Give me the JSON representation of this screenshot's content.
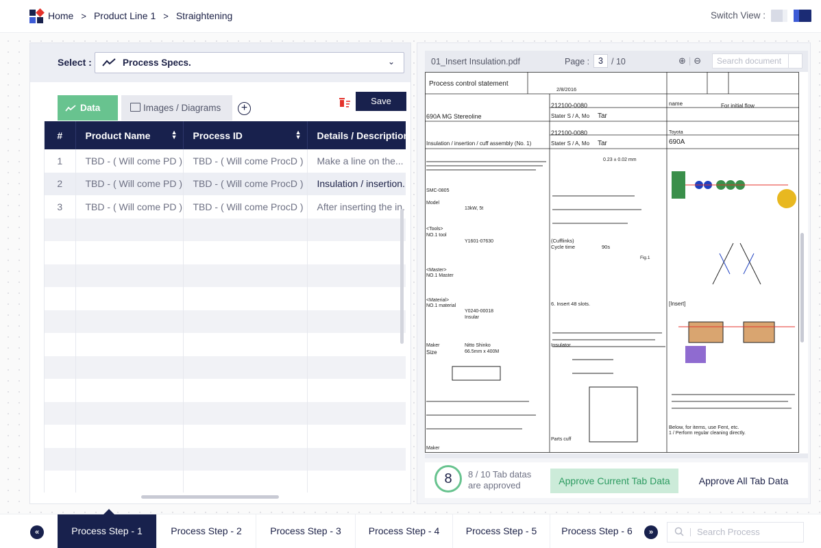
{
  "breadcrumb": {
    "home": "Home",
    "product_line": "Product Line 1",
    "current": "Straightening",
    "separator": ">"
  },
  "switch_view": {
    "label": "Switch View :"
  },
  "select": {
    "label": "Select :",
    "value": "Process Specs.",
    "icon": "trend-line-icon"
  },
  "tabs": {
    "data": "Data",
    "images": "Images / Diagrams"
  },
  "toolbar": {
    "save": "Save"
  },
  "table": {
    "columns": [
      "#",
      "Product Name",
      "Process ID",
      "Details / Description"
    ],
    "rows": [
      {
        "num": "1",
        "product": "TBD - ( Will come PD )",
        "process": "TBD - ( Will come ProcD )",
        "details": "Make a line on the..."
      },
      {
        "num": "2",
        "product": "TBD - ( Will come PD )",
        "process": "TBD - ( Will come ProcD )",
        "details": "Insulation / insertion.."
      },
      {
        "num": "3",
        "product": "TBD - ( Will come PD )",
        "process": "TBD - ( Will come ProcD )",
        "details": "After inserting the in.."
      }
    ]
  },
  "viewer": {
    "file_name": "01_Insert Insulation.pdf",
    "page_label": "Page :",
    "page": "3",
    "total": "/ 10",
    "search_placeholder": "Search document",
    "doc": {
      "title": "Process control statement",
      "date": "2/8/2016",
      "model": "690A MG Stereoline",
      "part1": "212100-0080",
      "part2": "212100-0080",
      "stater": "Stater S / A, Mo",
      "tar": "Tar",
      "name_label": "name",
      "for_initial": "For initial flow",
      "toyota": "Toyota",
      "model_code": "690A",
      "process_name": "Insulation / insertion / cuff assembly (No. 1)",
      "cufflinks": "(Cufflinks)",
      "cycle": "Cycle time",
      "cycle_val": "90s",
      "insert": "[Insert]",
      "insulator": "Insulator",
      "parts_cuff": "Parts cuff",
      "tools": "<Tools>",
      "tool_no": "NO.1 tool",
      "tool_id": "Y1601-07630",
      "master": "<Master>",
      "master_no": "NO.1 Master",
      "material": "<Material>",
      "material_no": "NO.1 material",
      "mat_id": "Y0240-00018",
      "mat_name": "Insular",
      "maker": "Maker",
      "size": "Size",
      "nitto": "Nitto Shinko",
      "size_val": "66.5mm x 400M",
      "slots": "6. Insert 48 slots.",
      "below": "Below, for items, use Fent, etc.",
      "cleaning": "1 / Perform regular cleaning directly.",
      "smc": "SMC-0805",
      "model_label": "Model",
      "kw": "13kW, 5t",
      "gap": "0.23 ± 0.02 mm",
      "fig": "Fig.1"
    }
  },
  "approval": {
    "count": "8",
    "text_line1": "8 / 10 Tab datas",
    "text_line2": "are approved",
    "approve_current": "Approve Current Tab Data",
    "approve_all": "Approve All Tab Data"
  },
  "steps": [
    "Process Step - 1",
    "Process Step - 2",
    "Process Step - 3",
    "Process Step - 4",
    "Process Step - 5",
    "Process Step - 6"
  ],
  "nav": {
    "prev": "«",
    "next": "»"
  },
  "process_search": {
    "placeholder": "Search Process"
  },
  "colors": {
    "navy": "#18214d",
    "green": "#68c38f",
    "light_green": "#ccebd9",
    "red": "#e4322b",
    "blue": "#3d5bd6"
  }
}
